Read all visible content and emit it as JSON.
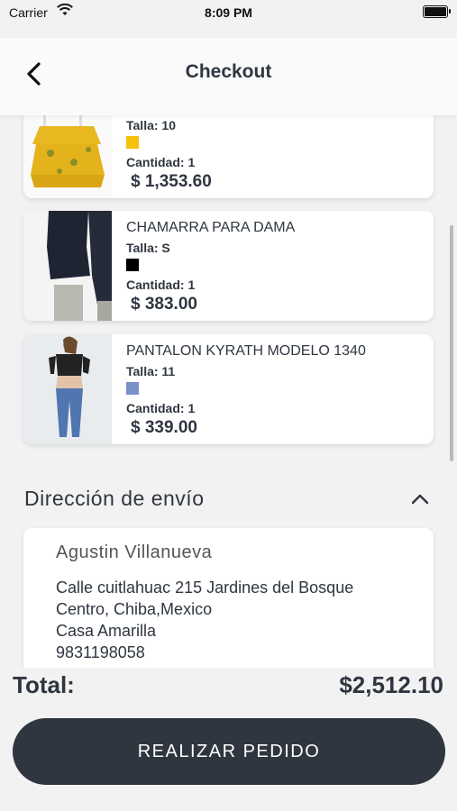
{
  "status_bar": {
    "carrier": "Carrier",
    "time": "8:09 PM"
  },
  "nav": {
    "title": "Checkout"
  },
  "cart_items": [
    {
      "name": "",
      "size_label": "Talla: 10",
      "color": "#f4c20d",
      "quantity_label": "Cantidad: 1",
      "price": "$ 1,353.60"
    },
    {
      "name": "CHAMARRA PARA DAMA",
      "size_label": "Talla: S",
      "color": "#000000",
      "quantity_label": "Cantidad: 1",
      "price": "$ 383.00"
    },
    {
      "name": "PANTALON KYRATH MODELO 1340",
      "size_label": "Talla: 11",
      "color": "#7b8fc8",
      "quantity_label": "Cantidad: 1",
      "price": "$ 339.00"
    }
  ],
  "shipping": {
    "section_title": "Dirección de envío",
    "recipient": "Agustin Villanueva",
    "address_lines": [
      "Calle cuitlahuac 215 Jardines del Bosque",
      "Centro, Chiba,Mexico",
      "Casa Amarilla",
      "9831198058"
    ]
  },
  "summary": {
    "total_label": "Total:",
    "total_value": "$2,512.10"
  },
  "actions": {
    "place_order_label": "REALIZAR PEDIDO"
  },
  "colors": {
    "primary": "#2f3640",
    "background": "#f2f2f2"
  }
}
